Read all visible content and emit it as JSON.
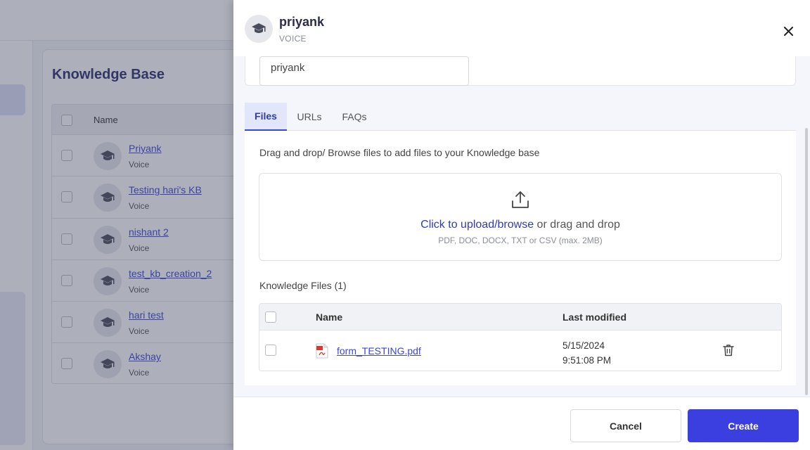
{
  "background": {
    "title": "Knowledge Base",
    "table": {
      "header_name": "Name",
      "rows": [
        {
          "name": "Priyank",
          "type": "Voice"
        },
        {
          "name": "Testing hari's KB",
          "type": "Voice"
        },
        {
          "name": "nishant 2",
          "type": "Voice"
        },
        {
          "name": "test_kb_creation_2",
          "type": "Voice"
        },
        {
          "name": "hari test",
          "type": "Voice"
        },
        {
          "name": "Akshay",
          "type": "Voice"
        }
      ]
    }
  },
  "drawer": {
    "header": {
      "name": "priyank",
      "type": "VOICE",
      "avatar_icon": "graduation-cap-icon",
      "close_icon": "close-icon"
    },
    "name_field": {
      "value": "priyank"
    },
    "tabs": [
      {
        "label": "Files",
        "active": true
      },
      {
        "label": "URLs",
        "active": false
      },
      {
        "label": "FAQs",
        "active": false
      }
    ],
    "files": {
      "description": "Drag and drop/ Browse files to add files to your Knowledge base",
      "upload": {
        "icon": "upload-icon",
        "link_text": "Click to upload/browse",
        "rest_text": " or drag and drop",
        "hint": "PDF, DOC, DOCX, TXT or CSV (max. 2MB)"
      },
      "list_title": "Knowledge Files (1)",
      "columns": [
        "Name",
        "Last modified"
      ],
      "items": [
        {
          "name": "form_TESTING.pdf",
          "date": "5/15/2024",
          "time": "9:51:08 PM",
          "icon": "pdf-icon",
          "action_icon": "trash-icon"
        }
      ]
    },
    "footer": {
      "cancel_label": "Cancel",
      "create_label": "Create"
    }
  },
  "colors": {
    "accent": "#3b3fe0",
    "link": "#3b46d8",
    "active_tab_bg": "#e2e6fb"
  }
}
